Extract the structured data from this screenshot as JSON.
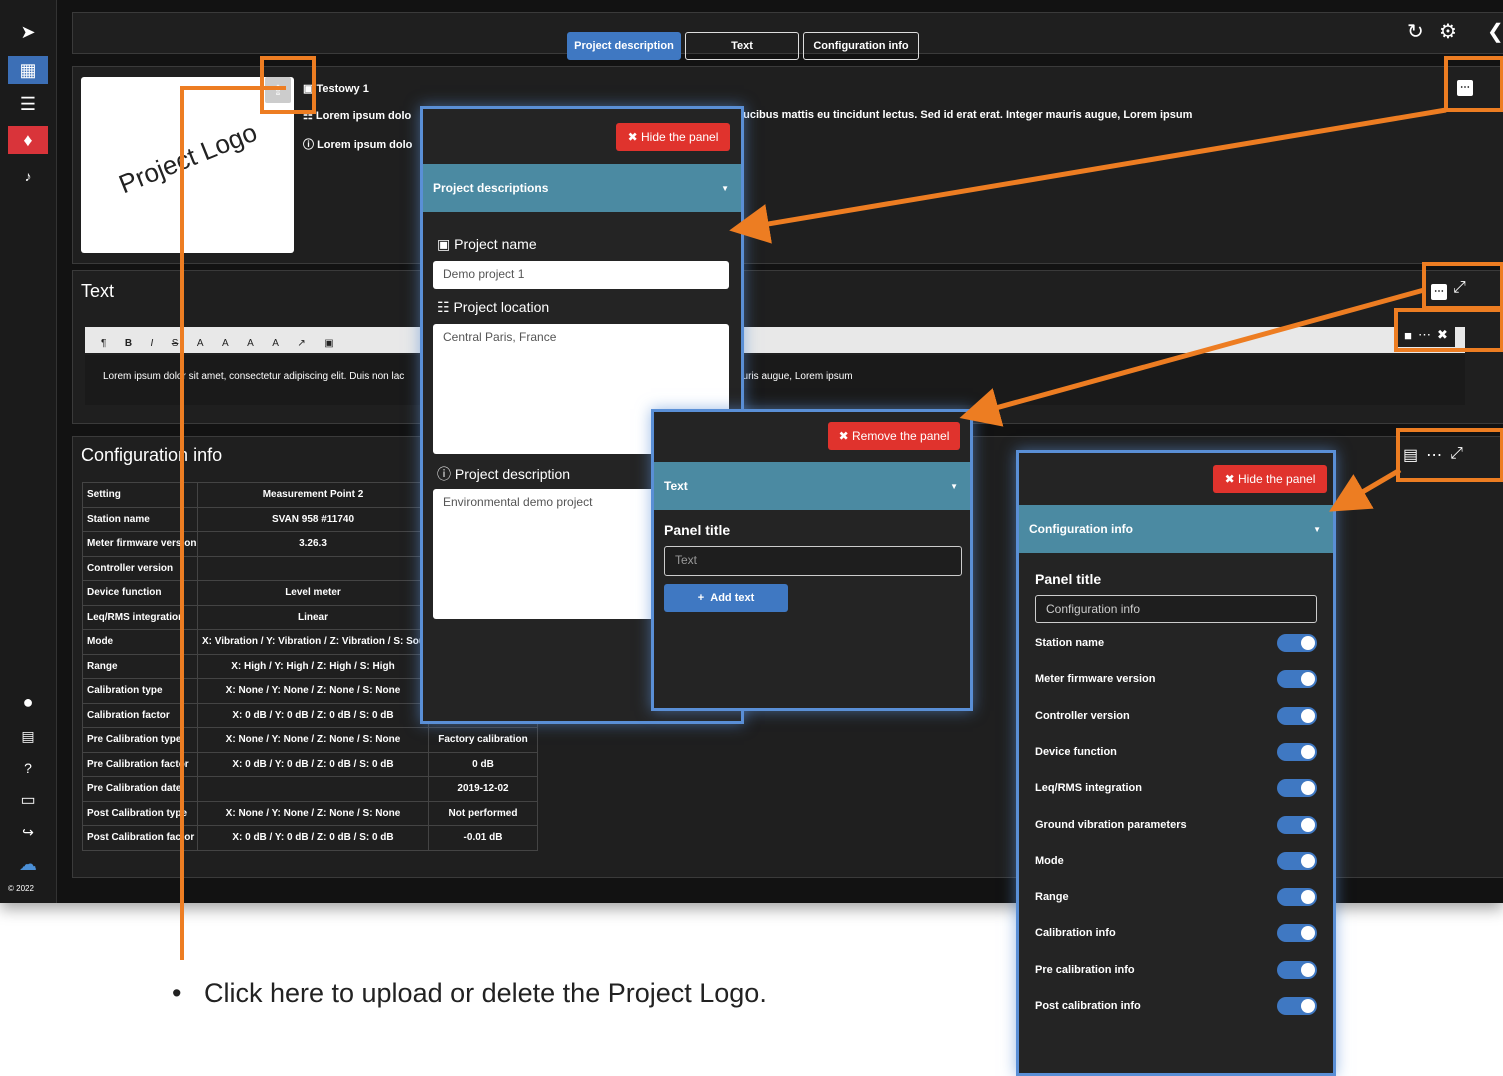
{
  "tabs": [
    "Project description",
    "Text",
    "Configuration info"
  ],
  "project": {
    "logo_text": "Project Logo",
    "name": "Testowy 1",
    "location": "Lorem ipsum dolo",
    "location_tail": "aucibus mattis eu tincidunt lectus. Sed id erat erat. Integer mauris augue, Lorem ipsum",
    "description": "Lorem ipsum dolo"
  },
  "text_panel": {
    "title": "Text",
    "toolbar": [
      "¶",
      "B",
      "I",
      "S",
      "A",
      "A",
      "A",
      "A",
      "↗",
      "▣"
    ],
    "content": "Lorem ipsum dolor sit amet, consectetur adipiscing elit. Duis non lac",
    "content_tail": "auris augue, Lorem ipsum"
  },
  "config": {
    "title": "Configuration info",
    "headers": [
      "Setting",
      "Measurement Point 2",
      ""
    ],
    "rows": [
      [
        "Station name",
        "SVAN 958 #11740",
        ""
      ],
      [
        "Meter firmware version",
        "3.26.3",
        ""
      ],
      [
        "Controller version",
        "",
        ""
      ],
      [
        "Device function",
        "Level meter",
        ""
      ],
      [
        "Leq/RMS integration",
        "Linear",
        ""
      ],
      [
        "Mode",
        "X: Vibration / Y: Vibration / Z: Vibration / S: Sound",
        ""
      ],
      [
        "Range",
        "X: High / Y: High / Z: High / S: High",
        ""
      ],
      [
        "Calibration type",
        "X: None / Y: None / Z: None / S: None",
        ""
      ],
      [
        "Calibration factor",
        "X: 0 dB / Y: 0 dB / Z: 0 dB / S: 0 dB",
        ""
      ],
      [
        "Pre Calibration type",
        "X: None / Y: None / Z: None / S: None",
        "Factory calibration"
      ],
      [
        "Pre Calibration factor",
        "X: 0 dB / Y: 0 dB / Z: 0 dB / S: 0 dB",
        "0 dB"
      ],
      [
        "Pre Calibration date",
        "",
        "2019-12-02"
      ],
      [
        "Post Calibration type",
        "X: None / Y: None / Z: None / S: None",
        "Not performed"
      ],
      [
        "Post Calibration factor",
        "X: 0 dB / Y: 0 dB / Z: 0 dB / S: 0 dB",
        "-0.01 dB"
      ]
    ]
  },
  "overlay_project": {
    "hide": "Hide the panel",
    "section": "Project descriptions",
    "name_label": "Project name",
    "name_value": "Demo project 1",
    "location_label": "Project location",
    "location_value": "Central Paris, France",
    "desc_label": "Project description",
    "desc_value": "Environmental demo project"
  },
  "overlay_text": {
    "remove": "Remove the panel",
    "section": "Text",
    "title_label": "Panel title",
    "title_placeholder": "Text",
    "add": "Add text"
  },
  "overlay_config": {
    "hide": "Hide the panel",
    "section": "Configuration info",
    "title_label": "Panel title",
    "title_value": "Configuration info",
    "toggles": [
      "Station name",
      "Meter firmware version",
      "Controller version",
      "Device function",
      "Leq/RMS integration",
      "Ground vibration parameters",
      "Mode",
      "Range",
      "Calibration info",
      "Pre calibration info",
      "Post calibration info"
    ]
  },
  "copyright": "© 2022",
  "caption": "Click here to upload or delete the Project Logo.",
  "colors": {
    "accent": "#3f78c2",
    "danger": "#e0332d",
    "annotation": "#ed7d22",
    "teal": "#4b8aa2"
  }
}
